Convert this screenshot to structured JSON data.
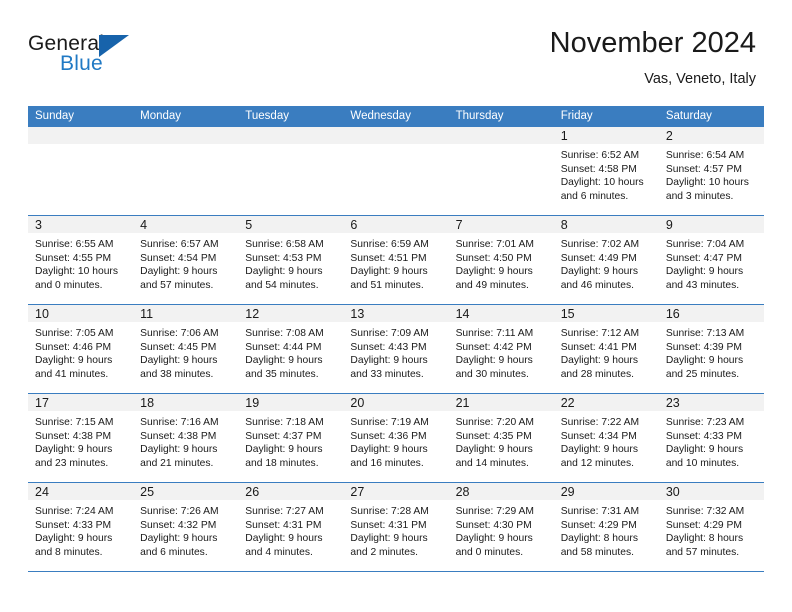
{
  "brand": {
    "word_one": "General",
    "word_two": "Blue",
    "triangle_color": "#1763ab",
    "blue_text_color": "#2079c4"
  },
  "header": {
    "title": "November 2024",
    "subtitle": "Vas, Veneto, Italy"
  },
  "calendar": {
    "header_bg": "#3a7dc0",
    "daynum_band_bg": "#f2f2f2",
    "weekday_headers": [
      "Sunday",
      "Monday",
      "Tuesday",
      "Wednesday",
      "Thursday",
      "Friday",
      "Saturday"
    ],
    "weeks": [
      [
        {
          "day": "",
          "lines": []
        },
        {
          "day": "",
          "lines": []
        },
        {
          "day": "",
          "lines": []
        },
        {
          "day": "",
          "lines": []
        },
        {
          "day": "",
          "lines": []
        },
        {
          "day": "1",
          "lines": [
            "Sunrise: 6:52 AM",
            "Sunset: 4:58 PM",
            "Daylight: 10 hours",
            "and 6 minutes."
          ]
        },
        {
          "day": "2",
          "lines": [
            "Sunrise: 6:54 AM",
            "Sunset: 4:57 PM",
            "Daylight: 10 hours",
            "and 3 minutes."
          ]
        }
      ],
      [
        {
          "day": "3",
          "lines": [
            "Sunrise: 6:55 AM",
            "Sunset: 4:55 PM",
            "Daylight: 10 hours",
            "and 0 minutes."
          ]
        },
        {
          "day": "4",
          "lines": [
            "Sunrise: 6:57 AM",
            "Sunset: 4:54 PM",
            "Daylight: 9 hours",
            "and 57 minutes."
          ]
        },
        {
          "day": "5",
          "lines": [
            "Sunrise: 6:58 AM",
            "Sunset: 4:53 PM",
            "Daylight: 9 hours",
            "and 54 minutes."
          ]
        },
        {
          "day": "6",
          "lines": [
            "Sunrise: 6:59 AM",
            "Sunset: 4:51 PM",
            "Daylight: 9 hours",
            "and 51 minutes."
          ]
        },
        {
          "day": "7",
          "lines": [
            "Sunrise: 7:01 AM",
            "Sunset: 4:50 PM",
            "Daylight: 9 hours",
            "and 49 minutes."
          ]
        },
        {
          "day": "8",
          "lines": [
            "Sunrise: 7:02 AM",
            "Sunset: 4:49 PM",
            "Daylight: 9 hours",
            "and 46 minutes."
          ]
        },
        {
          "day": "9",
          "lines": [
            "Sunrise: 7:04 AM",
            "Sunset: 4:47 PM",
            "Daylight: 9 hours",
            "and 43 minutes."
          ]
        }
      ],
      [
        {
          "day": "10",
          "lines": [
            "Sunrise: 7:05 AM",
            "Sunset: 4:46 PM",
            "Daylight: 9 hours",
            "and 41 minutes."
          ]
        },
        {
          "day": "11",
          "lines": [
            "Sunrise: 7:06 AM",
            "Sunset: 4:45 PM",
            "Daylight: 9 hours",
            "and 38 minutes."
          ]
        },
        {
          "day": "12",
          "lines": [
            "Sunrise: 7:08 AM",
            "Sunset: 4:44 PM",
            "Daylight: 9 hours",
            "and 35 minutes."
          ]
        },
        {
          "day": "13",
          "lines": [
            "Sunrise: 7:09 AM",
            "Sunset: 4:43 PM",
            "Daylight: 9 hours",
            "and 33 minutes."
          ]
        },
        {
          "day": "14",
          "lines": [
            "Sunrise: 7:11 AM",
            "Sunset: 4:42 PM",
            "Daylight: 9 hours",
            "and 30 minutes."
          ]
        },
        {
          "day": "15",
          "lines": [
            "Sunrise: 7:12 AM",
            "Sunset: 4:41 PM",
            "Daylight: 9 hours",
            "and 28 minutes."
          ]
        },
        {
          "day": "16",
          "lines": [
            "Sunrise: 7:13 AM",
            "Sunset: 4:39 PM",
            "Daylight: 9 hours",
            "and 25 minutes."
          ]
        }
      ],
      [
        {
          "day": "17",
          "lines": [
            "Sunrise: 7:15 AM",
            "Sunset: 4:38 PM",
            "Daylight: 9 hours",
            "and 23 minutes."
          ]
        },
        {
          "day": "18",
          "lines": [
            "Sunrise: 7:16 AM",
            "Sunset: 4:38 PM",
            "Daylight: 9 hours",
            "and 21 minutes."
          ]
        },
        {
          "day": "19",
          "lines": [
            "Sunrise: 7:18 AM",
            "Sunset: 4:37 PM",
            "Daylight: 9 hours",
            "and 18 minutes."
          ]
        },
        {
          "day": "20",
          "lines": [
            "Sunrise: 7:19 AM",
            "Sunset: 4:36 PM",
            "Daylight: 9 hours",
            "and 16 minutes."
          ]
        },
        {
          "day": "21",
          "lines": [
            "Sunrise: 7:20 AM",
            "Sunset: 4:35 PM",
            "Daylight: 9 hours",
            "and 14 minutes."
          ]
        },
        {
          "day": "22",
          "lines": [
            "Sunrise: 7:22 AM",
            "Sunset: 4:34 PM",
            "Daylight: 9 hours",
            "and 12 minutes."
          ]
        },
        {
          "day": "23",
          "lines": [
            "Sunrise: 7:23 AM",
            "Sunset: 4:33 PM",
            "Daylight: 9 hours",
            "and 10 minutes."
          ]
        }
      ],
      [
        {
          "day": "24",
          "lines": [
            "Sunrise: 7:24 AM",
            "Sunset: 4:33 PM",
            "Daylight: 9 hours",
            "and 8 minutes."
          ]
        },
        {
          "day": "25",
          "lines": [
            "Sunrise: 7:26 AM",
            "Sunset: 4:32 PM",
            "Daylight: 9 hours",
            "and 6 minutes."
          ]
        },
        {
          "day": "26",
          "lines": [
            "Sunrise: 7:27 AM",
            "Sunset: 4:31 PM",
            "Daylight: 9 hours",
            "and 4 minutes."
          ]
        },
        {
          "day": "27",
          "lines": [
            "Sunrise: 7:28 AM",
            "Sunset: 4:31 PM",
            "Daylight: 9 hours",
            "and 2 minutes."
          ]
        },
        {
          "day": "28",
          "lines": [
            "Sunrise: 7:29 AM",
            "Sunset: 4:30 PM",
            "Daylight: 9 hours",
            "and 0 minutes."
          ]
        },
        {
          "day": "29",
          "lines": [
            "Sunrise: 7:31 AM",
            "Sunset: 4:29 PM",
            "Daylight: 8 hours",
            "and 58 minutes."
          ]
        },
        {
          "day": "30",
          "lines": [
            "Sunrise: 7:32 AM",
            "Sunset: 4:29 PM",
            "Daylight: 8 hours",
            "and 57 minutes."
          ]
        }
      ]
    ]
  }
}
